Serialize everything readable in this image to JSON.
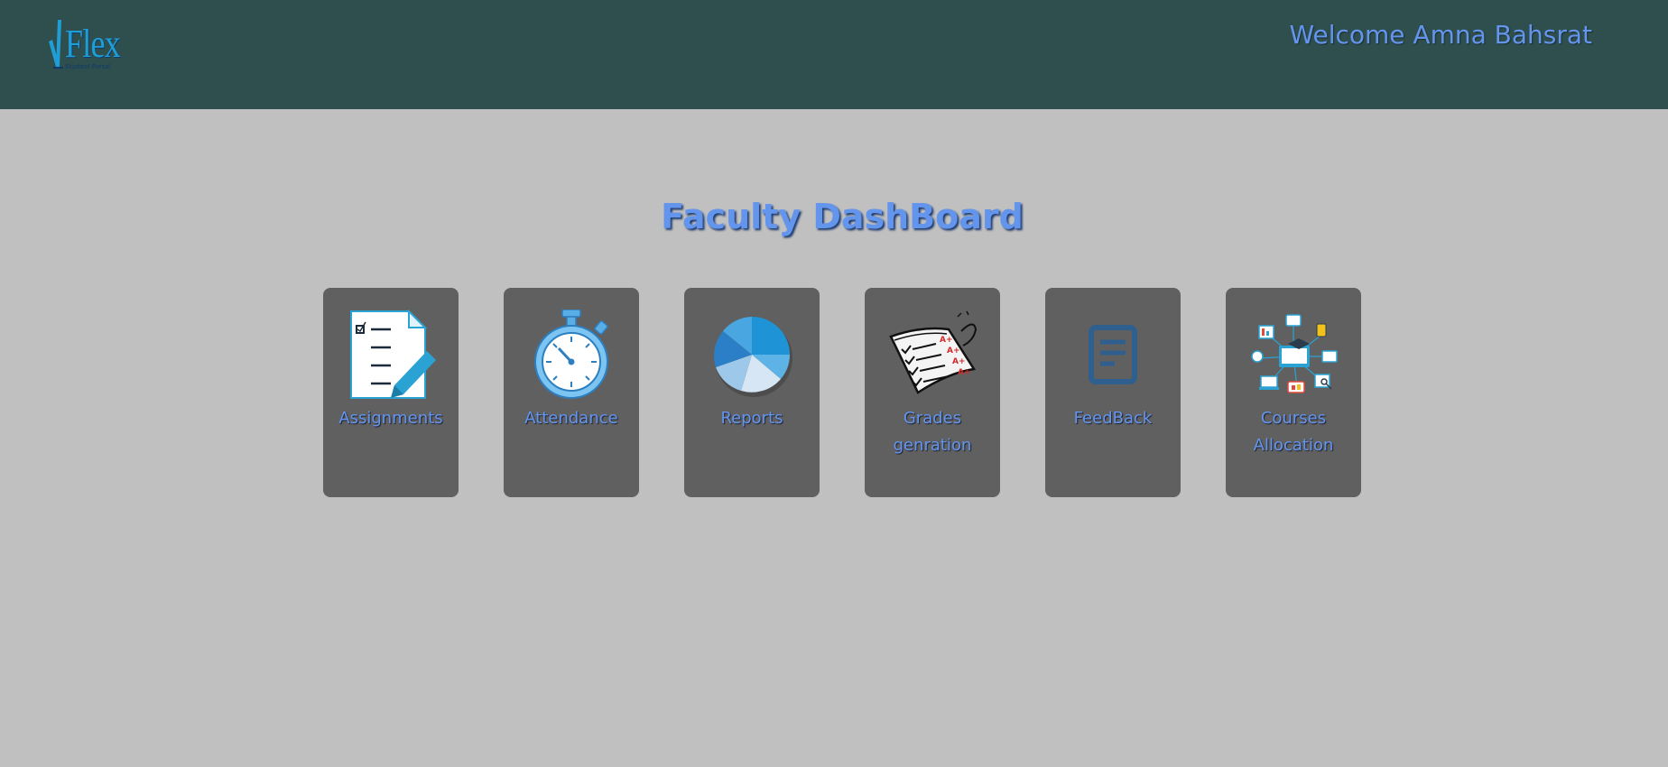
{
  "header": {
    "logo_text": "Flex",
    "logo_subtext": "Student Portal",
    "welcome": "Welcome Amna Bahsrat"
  },
  "main": {
    "title": "Faculty DashBoard",
    "cards": [
      {
        "label": "Assignments",
        "icon": "assignment-checklist-icon"
      },
      {
        "label": "Attendance",
        "icon": "stopwatch-icon"
      },
      {
        "label": "Reports",
        "icon": "pie-chart-icon"
      },
      {
        "label": "Grades genration",
        "icon": "graded-paper-icon"
      },
      {
        "label": "FeedBack",
        "icon": "document-icon"
      },
      {
        "label": "Courses Allocation",
        "icon": "e-learning-network-icon"
      }
    ]
  },
  "colors": {
    "header_bg": "#2f4f4f",
    "page_bg": "#c0c0c0",
    "card_bg": "#606060",
    "accent_text": "#6495ed"
  }
}
